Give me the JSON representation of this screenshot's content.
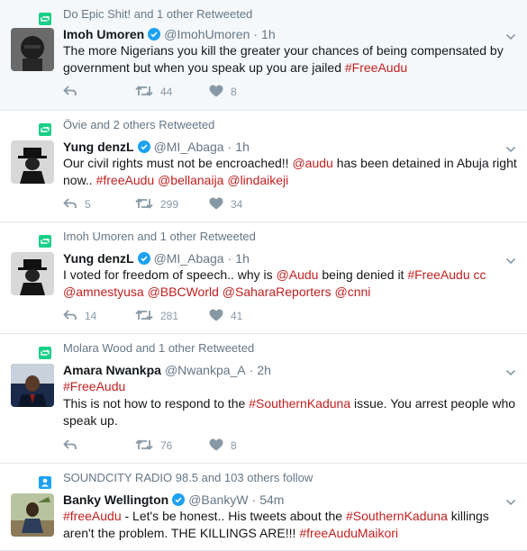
{
  "tweets": [
    {
      "context": "Do Epic Shit! and 1 other Retweeted",
      "context_icon": "retweet-icon",
      "name": "Imoh Umoren",
      "verified": true,
      "handle": "@ImohUmoren",
      "time": "1h",
      "text_parts": [
        {
          "t": "The more Nigerians you kill the greater your chances of being compensated by government but when you speak up you are jailed ",
          "link": false
        },
        {
          "t": "#FreeAudu",
          "link": true
        }
      ],
      "replies": "",
      "retweets": "44",
      "likes": "8"
    },
    {
      "context": "Övie and 2 others Retweeted",
      "context_icon": "retweet-icon",
      "name": "Yung denzL",
      "verified": true,
      "handle": "@MI_Abaga",
      "time": "1h",
      "text_parts": [
        {
          "t": "Our civil rights must not be encroached!! ",
          "link": false
        },
        {
          "t": "@audu",
          "link": true
        },
        {
          "t": " has been detained in Abuja right now.. ",
          "link": false
        },
        {
          "t": "#freeAudu",
          "link": true
        },
        {
          "t": " ",
          "link": false
        },
        {
          "t": "@bellanaija",
          "link": true
        },
        {
          "t": " ",
          "link": false
        },
        {
          "t": "@lindaikeji",
          "link": true
        }
      ],
      "replies": "5",
      "retweets": "299",
      "likes": "34"
    },
    {
      "context": "Imoh Umoren and 1 other Retweeted",
      "context_icon": "retweet-icon",
      "name": "Yung denzL",
      "verified": true,
      "handle": "@MI_Abaga",
      "time": "1h",
      "text_parts": [
        {
          "t": "I voted for freedom of speech.. why is ",
          "link": false
        },
        {
          "t": "@Audu",
          "link": true
        },
        {
          "t": " being denied it ",
          "link": false
        },
        {
          "t": "#FreeAudu",
          "link": true
        },
        {
          "t": " ",
          "link": false
        },
        {
          "t": "cc",
          "link": true
        },
        {
          "t": " ",
          "link": false
        },
        {
          "t": "@amnestyusa",
          "link": true
        },
        {
          "t": " ",
          "link": false
        },
        {
          "t": "@BBCWorld",
          "link": true
        },
        {
          "t": " ",
          "link": false
        },
        {
          "t": "@SaharaReporters",
          "link": true
        },
        {
          "t": " ",
          "link": false
        },
        {
          "t": "@cnni",
          "link": true
        }
      ],
      "replies": "14",
      "retweets": "281",
      "likes": "41"
    },
    {
      "context": "Molara Wood and 1 other Retweeted",
      "context_icon": "retweet-icon",
      "name": "Amara Nwankpa",
      "verified": false,
      "handle": "@Nwankpa_A",
      "time": "2h",
      "text_parts": [
        {
          "t": "#FreeAudu",
          "link": true
        },
        {
          "t": "\n",
          "link": false
        },
        {
          "t": "This is not how to respond to the ",
          "link": false
        },
        {
          "t": "#SouthernKaduna",
          "link": true
        },
        {
          "t": " issue. You arrest people who speak up.",
          "link": false
        }
      ],
      "replies": "",
      "retweets": "76",
      "likes": "8"
    },
    {
      "context": "SOUNDCITY RADIO 98.5 and 103 others follow",
      "context_icon": "person-icon",
      "name": "Banky Wellington",
      "verified": true,
      "handle": "@BankyW",
      "time": "54m",
      "text_parts": [
        {
          "t": "#freeAudu",
          "link": true
        },
        {
          "t": " - Let's be honest.. His tweets about the ",
          "link": false
        },
        {
          "t": "#SouthernKaduna",
          "link": true
        },
        {
          "t": " killings aren't the problem. THE KILLINGS ARE!!! ",
          "link": false
        },
        {
          "t": "#freeAuduMaikori",
          "link": true
        }
      ],
      "replies": "",
      "retweets": "",
      "likes": ""
    }
  ],
  "colors": {
    "link": "#c31f1f",
    "retweet_context": "#19cf86",
    "follow_context": "#1da1f2",
    "verified": "#1da1f2",
    "meta": "#657786",
    "action": "#8899a6"
  }
}
